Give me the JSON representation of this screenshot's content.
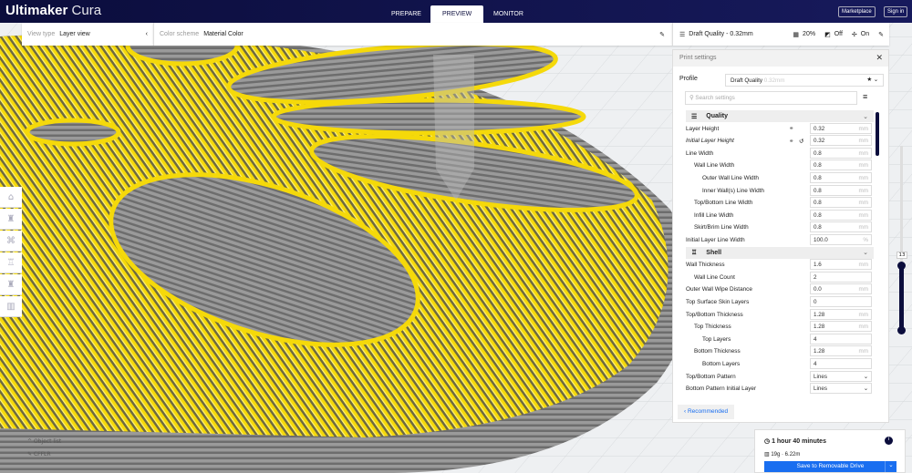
{
  "app": {
    "brand_bold": "Ultimaker",
    "brand_light": "Cura"
  },
  "stages": [
    "PREPARE",
    "PREVIEW",
    "MONITOR"
  ],
  "header_buttons": {
    "marketplace": "Marketplace",
    "signin": "Sign in"
  },
  "view": {
    "type_label": "View type",
    "type_value": "Layer view",
    "scheme_label": "Color scheme",
    "scheme_value": "Material Color"
  },
  "print_summary": {
    "profile": "Draft Quality - 0.32mm",
    "infill": "20%",
    "support": "Off",
    "adhesion": "On"
  },
  "panel": {
    "title": "Print settings",
    "profile_label": "Profile",
    "profile_value": "Draft Quality",
    "profile_hint": "0.32mm",
    "search_placeholder": "Search settings",
    "recommended": "Recommended"
  },
  "categories": {
    "quality": "Quality",
    "shell": "Shell"
  },
  "quality_settings": [
    {
      "label": "Layer Height",
      "value": "0.32",
      "unit": "mm",
      "indent": 0
    },
    {
      "label": "Initial Layer Height",
      "value": "0.32",
      "unit": "mm",
      "indent": 0
    },
    {
      "label": "Line Width",
      "value": "0.8",
      "unit": "mm",
      "indent": 0
    },
    {
      "label": "Wall Line Width",
      "value": "0.8",
      "unit": "mm",
      "indent": 1
    },
    {
      "label": "Outer Wall Line Width",
      "value": "0.8",
      "unit": "mm",
      "indent": 2
    },
    {
      "label": "Inner Wall(s) Line Width",
      "value": "0.8",
      "unit": "mm",
      "indent": 2
    },
    {
      "label": "Top/Bottom Line Width",
      "value": "0.8",
      "unit": "mm",
      "indent": 1
    },
    {
      "label": "Infill Line Width",
      "value": "0.8",
      "unit": "mm",
      "indent": 1
    },
    {
      "label": "Skirt/Brim Line Width",
      "value": "0.8",
      "unit": "mm",
      "indent": 1
    },
    {
      "label": "Initial Layer Line Width",
      "value": "100.0",
      "unit": "%",
      "indent": 0
    }
  ],
  "shell_settings": [
    {
      "label": "Wall Thickness",
      "value": "1.6",
      "unit": "mm",
      "indent": 0
    },
    {
      "label": "Wall Line Count",
      "value": "2",
      "unit": "",
      "indent": 1
    },
    {
      "label": "Outer Wall Wipe Distance",
      "value": "0.0",
      "unit": "mm",
      "indent": 0
    },
    {
      "label": "Top Surface Skin Layers",
      "value": "0",
      "unit": "",
      "indent": 0
    },
    {
      "label": "Top/Bottom Thickness",
      "value": "1.28",
      "unit": "mm",
      "indent": 0
    },
    {
      "label": "Top Thickness",
      "value": "1.28",
      "unit": "mm",
      "indent": 1
    },
    {
      "label": "Top Layers",
      "value": "4",
      "unit": "",
      "indent": 2
    },
    {
      "label": "Bottom Thickness",
      "value": "1.28",
      "unit": "mm",
      "indent": 1
    },
    {
      "label": "Bottom Layers",
      "value": "4",
      "unit": "",
      "indent": 2
    },
    {
      "label": "Top/Bottom Pattern",
      "value": "Lines",
      "unit": "v",
      "indent": 0
    },
    {
      "label": "Bottom Pattern Initial Layer",
      "value": "Lines",
      "unit": "v",
      "indent": 0
    }
  ],
  "layer_slider": {
    "current": "13",
    "fraction": 0.35
  },
  "output": {
    "time": "1 hour 40 minutes",
    "material": "19g · 6.22m",
    "save": "Save to Removable Drive"
  },
  "object_list": {
    "objects": "Object list",
    "file": "CFFLR"
  },
  "colors": {
    "header": "#0b0d3c",
    "accent": "#196ef0",
    "model": "#f5d90a"
  }
}
